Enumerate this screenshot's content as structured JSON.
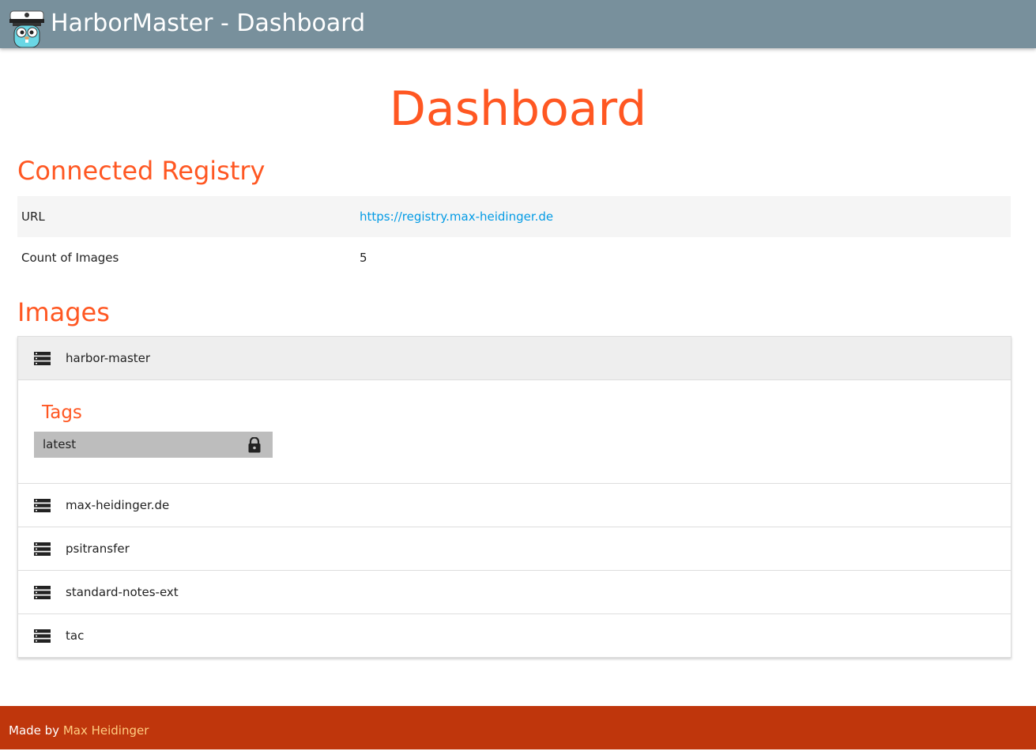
{
  "navbar": {
    "title": "HarborMaster - Dashboard",
    "logo_icon": "gopher-captain-logo"
  },
  "page": {
    "title": "Dashboard"
  },
  "registry": {
    "heading": "Connected Registry",
    "rows": [
      {
        "key": "URL",
        "value": "https://registry.max-heidinger.de"
      },
      {
        "key": "Count of Images",
        "value": "5"
      }
    ]
  },
  "images": {
    "heading": "Images",
    "items": [
      {
        "name": "harbor-master",
        "expanded": true,
        "icon": "storage-icon"
      },
      {
        "name": "max-heidinger.de",
        "expanded": false,
        "icon": "storage-icon"
      },
      {
        "name": "psitransfer",
        "expanded": false,
        "icon": "storage-icon"
      },
      {
        "name": "standard-notes-ext",
        "expanded": false,
        "icon": "storage-icon"
      },
      {
        "name": "tac",
        "expanded": false,
        "icon": "storage-icon"
      }
    ],
    "expanded_body": {
      "tags_heading": "Tags",
      "tags": [
        {
          "name": "latest",
          "icon": "lock-icon"
        }
      ]
    }
  },
  "footer": {
    "prefix": "Made by ",
    "author": "Max Heidinger"
  },
  "colors": {
    "navbar": "#78909c",
    "accent": "#ff5722",
    "link": "#039be5",
    "footer": "#bf360c",
    "footer_link": "#ffcc80",
    "tag_chip": "#bdbdbd"
  }
}
